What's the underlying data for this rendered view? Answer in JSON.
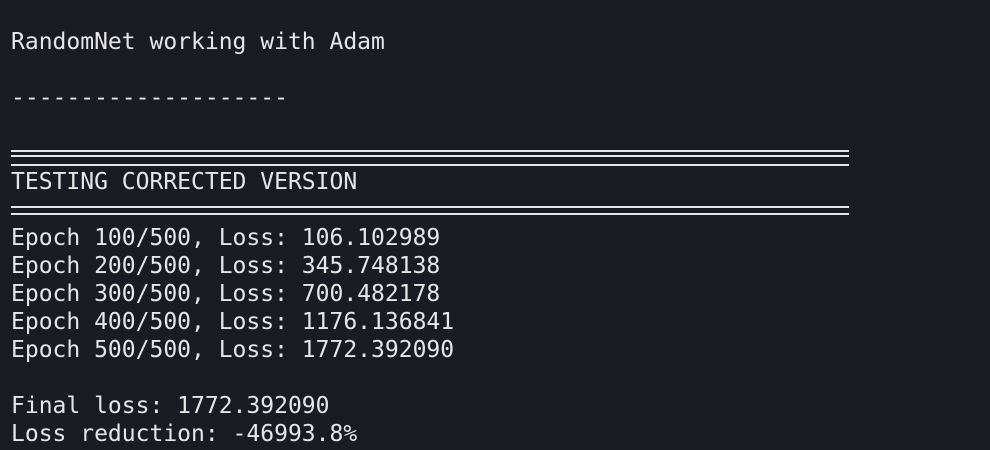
{
  "terminal": {
    "header": "RandomNet working with Adam",
    "dash_rule": "--------------------",
    "banner_title": "TESTING CORRECTED VERSION",
    "epochs": [
      "Epoch 100/500, Loss: 106.102989",
      "Epoch 200/500, Loss: 345.748138",
      "Epoch 300/500, Loss: 700.482178",
      "Epoch 400/500, Loss: 1176.136841",
      "Epoch 500/500, Loss: 1772.392090"
    ],
    "final_loss": "Final loss: 1772.392090",
    "loss_reduction": "Loss reduction: -46993.8%"
  }
}
